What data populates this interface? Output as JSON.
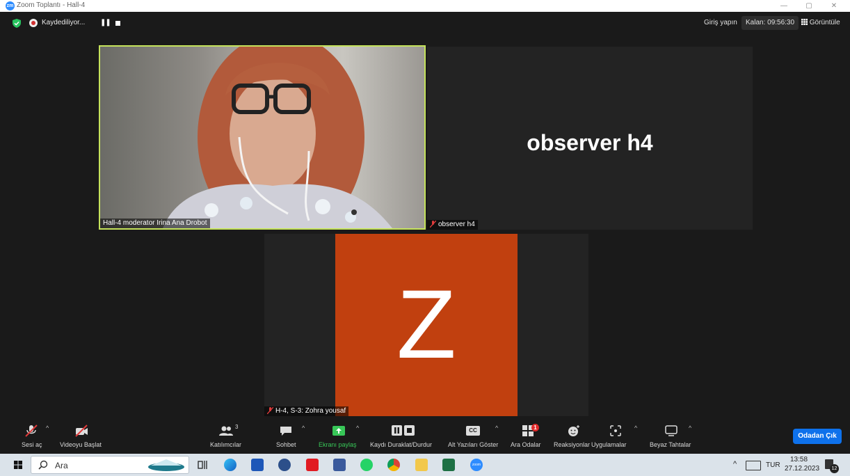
{
  "window": {
    "title": "Zoom Toplantı - Hall-4",
    "logo": "zm",
    "minimize": "—",
    "maximize": "▢",
    "close": "✕"
  },
  "topbar": {
    "recording_label": "Kaydediliyor...",
    "pause_glyph": "❚❚",
    "sign_in": "Giriş yapın",
    "remaining": "Kalan: 09:56:30",
    "view": "Görüntüle"
  },
  "tiles": {
    "video_label": "Hall-4 moderator Irina Ana Drobot",
    "observer_name": "observer h4",
    "observer_label": "observer h4",
    "avatar_letter": "Z",
    "avatar_label": "H-4, S-3: Zohra yousaf"
  },
  "colors": {
    "accent_green": "#38c758",
    "active_speaker": "#c5e35b",
    "leave_blue": "#0e71eb",
    "avatar_bg": "#c1400f"
  },
  "toolbar": {
    "unmute": "Sesi aç",
    "start_video": "Videoyu Başlat",
    "participants": "Katılımcılar",
    "participants_count": "3",
    "chat": "Sohbet",
    "share": "Ekranı paylaş",
    "recording_control": "Kaydı Duraklat/Durdur",
    "captions": "Alt Yazıları Göster",
    "captions_icon": "CC",
    "breakout": "Ara Odalar",
    "breakout_badge": "1",
    "reactions": "Reaksiyonlar",
    "apps": "Uygulamalar",
    "whiteboard": "Beyaz Tahtalar",
    "leave": "Odadan Çık",
    "caret": "^"
  },
  "taskbar": {
    "search_placeholder": "Ara",
    "lang": "TUR",
    "time": "13:58",
    "date": "27.12.2023",
    "notifications": "12",
    "tray_caret": "^",
    "zoom_app": "zoom"
  }
}
